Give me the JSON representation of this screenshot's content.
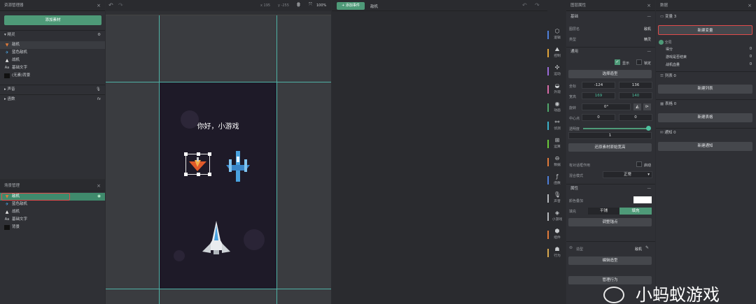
{
  "left_top": {
    "title": "资源管理器",
    "add_button": "添加素材",
    "sprite_section": "精灵",
    "sprites": [
      {
        "icon": "enemy-plane-icon",
        "label": "敌机"
      },
      {
        "icon": "blue-enemy-icon",
        "label": "蓝色敌机"
      },
      {
        "icon": "fighter-icon",
        "label": "战机"
      },
      {
        "icon": "text-icon",
        "label": "基础文字"
      },
      {
        "icon": "image-icon",
        "label": "(无素)背景"
      }
    ],
    "sound_section": "声音",
    "function_section": "函数",
    "function_badge": "fx"
  },
  "left_bottom": {
    "title": "场景管理",
    "items": [
      {
        "icon": "enemy-plane-icon",
        "label": "敌机"
      },
      {
        "icon": "blue-enemy-icon",
        "label": "蓝色敌机"
      },
      {
        "icon": "fighter-icon",
        "label": "战机"
      },
      {
        "icon": "text-icon",
        "label": "基础文字"
      },
      {
        "icon": "image-icon",
        "label": "背景"
      }
    ]
  },
  "canvas": {
    "coord_x": "x 195",
    "coord_y": "y -255",
    "zoom": "100%",
    "greeting": "你好，小游戏"
  },
  "event_area": {
    "add_event": "添加事件",
    "current": "敌机"
  },
  "sidebar": [
    {
      "icon": "logic-icon",
      "label": "逻辑",
      "color": "#4e7fd9"
    },
    {
      "icon": "control-icon",
      "label": "控制",
      "color": "#e0a43a"
    },
    {
      "icon": "motion-icon",
      "label": "运动",
      "color": "#9a6ad8"
    },
    {
      "icon": "appearance-icon",
      "label": "外观",
      "color": "#d86aa8"
    },
    {
      "icon": "animation-icon",
      "label": "动画",
      "color": "#4ea86a"
    },
    {
      "icon": "detect-icon",
      "label": "侦测",
      "color": "#3ab0c8"
    },
    {
      "icon": "operation-icon",
      "label": "运算",
      "color": "#6ac83a"
    },
    {
      "icon": "data-icon",
      "label": "数据",
      "color": "#e07a3a"
    },
    {
      "icon": "function-icon",
      "label": "函数",
      "color": "#4e7fd9"
    },
    {
      "icon": "sound-icon",
      "label": "声音",
      "color": "#b5b8bc"
    },
    {
      "icon": "minigame-icon",
      "label": "小游戏",
      "color": "#b5b8bc"
    },
    {
      "icon": "component-icon",
      "label": "组件",
      "color": "#e07a3a"
    },
    {
      "icon": "behavior-icon",
      "label": "行为",
      "color": "#d8a84e"
    }
  ],
  "props": {
    "title": "图层属性",
    "basic": "基础",
    "layer_name_label": "图层名",
    "layer_name": "敌机",
    "type_label": "类型",
    "type": "精灵",
    "general": "通用",
    "show_label": "显示",
    "lock_label": "锁定",
    "select_shape": "选择造型",
    "coords_label": "坐标",
    "x": "-124",
    "y": "136",
    "size_label": "宽高",
    "w": "169",
    "h": "140",
    "rotation_label": "旋转",
    "rotation": "0°",
    "center_label": "中心点",
    "cx": "0",
    "cy": "0",
    "opacity_label": "透明度",
    "opacity": "1",
    "opacity_level": 1.0,
    "restore": "还原素材原始宽高",
    "physics_label": "有对话框作用",
    "physics_toggle": "启动",
    "blend_label": "混合模式",
    "blend": "正常",
    "attr": "属性",
    "color_label": "颜色叠加",
    "fill_label": "填充",
    "tile": "平铺",
    "fill": "填充",
    "adjust_anchor": "调整锚点",
    "shape_label": "造型",
    "shape_value": "敌机",
    "edit_shape": "编辑造型",
    "manage_behavior": "管理行为"
  },
  "data": {
    "title": "数据",
    "variables": "变量 3",
    "new_variable": "新建变量",
    "global": "全局",
    "vars": [
      {
        "name": "得分",
        "value": "0"
      },
      {
        "name": "游戏是否结束",
        "value": "0"
      },
      {
        "name": "战机血量",
        "value": "0"
      }
    ],
    "lists": "列表 0",
    "new_list": "新建列表",
    "tables": "表格 0",
    "new_table": "新建表格",
    "notices": "通知 0",
    "new_notice": "新建通知"
  },
  "watermark": "小蚂蚁游戏"
}
